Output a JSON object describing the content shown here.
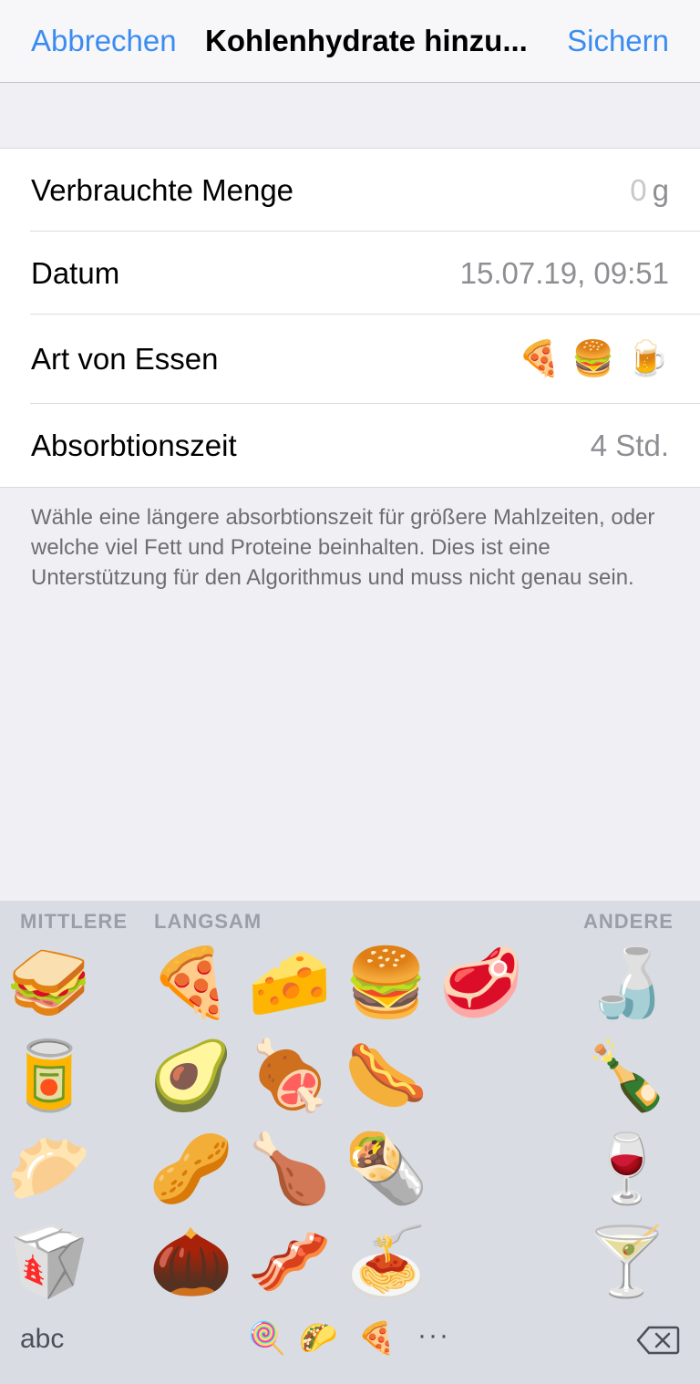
{
  "nav": {
    "cancel": "Abbrechen",
    "title": "Kohlenhydrate hinzu...",
    "save": "Sichern"
  },
  "rows": {
    "amount": {
      "label": "Verbrauchte Menge",
      "value": "0",
      "unit": "g"
    },
    "date": {
      "label": "Datum",
      "value": "15.07.19, 09:51"
    },
    "food_type": {
      "label": "Art von Essen",
      "emojis": [
        "🍕",
        "🍔",
        "🍺"
      ]
    },
    "absorption": {
      "label": "Absorbtionszeit",
      "value": "4 Std."
    }
  },
  "footnote": "Wähle eine längere absorbtionszeit für größere Mahlzeiten, oder welche viel Fett und Proteine beinhalten. Dies ist eine Unterstützung für den Algorithmus und muss nicht genau sein.",
  "keyboard": {
    "sections": {
      "medium": "MITTLERE",
      "slow": "LANGSAM",
      "other": "ANDERE"
    },
    "medium": [
      "🥪",
      "🥫",
      "🥟",
      "🥡"
    ],
    "slow": [
      "🍕",
      "🧀",
      "🍔",
      "🥩",
      "🥑",
      "🍖",
      "🌭",
      "🥜",
      "🍗",
      "🌯",
      "🌰",
      "🥓",
      "🍝"
    ],
    "other": [
      "🍶",
      "🍾",
      "🍷",
      "🍸"
    ],
    "abc": "abc",
    "tabs": [
      "🍭",
      "🌮",
      "🍕"
    ],
    "more": "···"
  }
}
